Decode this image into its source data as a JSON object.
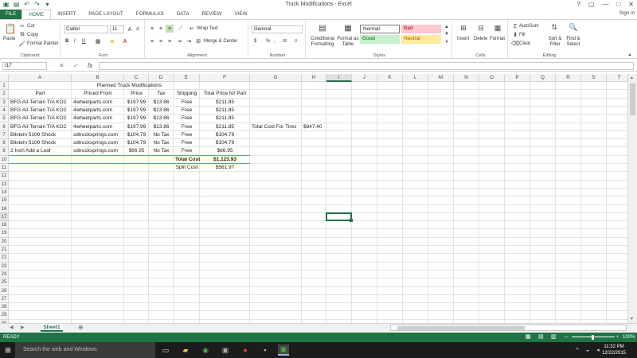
{
  "window": {
    "title": "Truck Modifications - Excel",
    "controls": {
      "help": "?",
      "restore": "▢",
      "minimize": "—",
      "maximize": "□",
      "close": "✕"
    }
  },
  "tabs": [
    "FILE",
    "HOME",
    "INSERT",
    "PAGE LAYOUT",
    "FORMULAS",
    "DATA",
    "REVIEW",
    "VIEW"
  ],
  "active_tab": "HOME",
  "signin": "Sign in",
  "ribbon": {
    "clipboard": {
      "paste": "Paste",
      "cut": "Cut",
      "copy": "Copy",
      "format_painter": "Format Painter",
      "label": "Clipboard"
    },
    "font": {
      "name": "Calibri",
      "size": "11",
      "bold": "B",
      "italic": "I",
      "underline": "U",
      "label": "Font"
    },
    "alignment": {
      "wrap_text": "Wrap Text",
      "merge_center": "Merge & Center",
      "label": "Alignment"
    },
    "number": {
      "format": "General",
      "currency": "$",
      "percent": "%",
      "comma": ",",
      "label": "Number"
    },
    "styles": {
      "conditional": "Conditional Formatting",
      "format_table": "Format as Table",
      "normal": "Normal",
      "bad": "Bad",
      "good": "Good",
      "neutral": "Neutral",
      "label": "Styles"
    },
    "cells": {
      "insert": "Insert",
      "delete": "Delete",
      "format": "Format",
      "label": "Cells"
    },
    "editing": {
      "autosum": "AutoSum",
      "fill": "Fill",
      "clear": "Clear",
      "sort": "Sort & Filter",
      "find": "Find & Select",
      "label": "Editing"
    }
  },
  "formula_bar": {
    "name_box": "I17",
    "value": ""
  },
  "columns": [
    "A",
    "B",
    "C",
    "D",
    "E",
    "F",
    "G",
    "H",
    "I",
    "J",
    "K",
    "L",
    "M",
    "N",
    "O",
    "P",
    "Q",
    "R",
    "S",
    "T"
  ],
  "selected_cell": "I17",
  "sheet": {
    "title": "Planned Truck Modifications",
    "headers": [
      "Part",
      "Priced From",
      "Price",
      "Tax",
      "Shipping",
      "Total Price for Part"
    ],
    "rows": [
      [
        "BFG All-Terrain T/A KO2",
        "4wheelparts.com",
        "$197.99",
        "$13.86",
        "Free",
        "$211.85"
      ],
      [
        "BFG All-Terrain T/A KO2",
        "4wheelparts.com",
        "$197.99",
        "$13.86",
        "Free",
        "$211.85"
      ],
      [
        "BFG All-Terrain T/A KO2",
        "4wheelparts.com",
        "$197.99",
        "$13.86",
        "Free",
        "$211.85"
      ],
      [
        "BFG All-Terrain T/A KO2",
        "4wheelparts.com",
        "$197.99",
        "$13.86",
        "Free",
        "$211.85"
      ],
      [
        "Bilstein 5100 Shock",
        "sdtrucksprings.com",
        "$104.79",
        "No Tax",
        "Free",
        "$104.79"
      ],
      [
        "Bilstein 5100 Shock",
        "sdtrucksprings.com",
        "$104.79",
        "No Tax",
        "Free",
        "$104.79"
      ],
      [
        "2 Inch Add a Leaf",
        "sdtrucksprings.com",
        "$66.95",
        "No Tax",
        "Free",
        "$66.95"
      ]
    ],
    "total_label": "Total Cost",
    "total_value": "$1,123.93",
    "split_label": "Split Cost",
    "split_value": "$561.97",
    "tires_label": "Total Cost For Tires",
    "tires_value": "$847.40"
  },
  "sheet_tabs": [
    "Sheet1"
  ],
  "status": {
    "ready": "READY",
    "zoom": "100%"
  },
  "taskbar": {
    "search": "Search the web and Windows",
    "time": "11:32 PM",
    "date": "12/22/2015"
  }
}
